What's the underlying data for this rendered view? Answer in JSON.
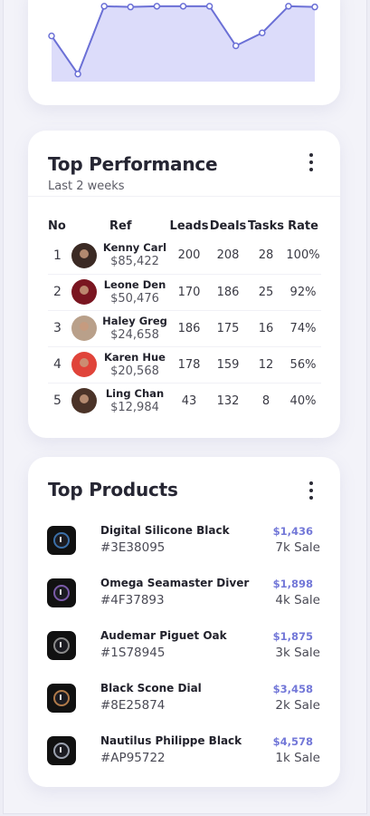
{
  "chart": {
    "fill_color": "#dcdcfa",
    "line_color": "#6b70d6",
    "points": [
      0.6,
      0.1,
      0.99,
      0.98,
      0.99,
      0.99,
      0.99,
      0.47,
      0.64,
      0.99,
      0.98
    ]
  },
  "performance": {
    "title": "Top Performance",
    "subtitle": "Last 2 weeks",
    "columns": [
      "No",
      "Ref",
      "Leads",
      "Deals",
      "Tasks",
      "Rate"
    ],
    "rows": [
      {
        "no": "1",
        "name": "Kenny Carl",
        "amount": "$85,422",
        "leads": "200",
        "deals": "208",
        "tasks": "28",
        "rate": "100%",
        "avatar_color": "#3b2a24"
      },
      {
        "no": "2",
        "name": "Leone Den",
        "amount": "$50,476",
        "leads": "170",
        "deals": "186",
        "tasks": "25",
        "rate": "92%",
        "avatar_color": "#7a1520"
      },
      {
        "no": "3",
        "name": "Haley Greg",
        "amount": "$24,658",
        "leads": "186",
        "deals": "175",
        "tasks": "16",
        "rate": "74%",
        "avatar_color": "#b9a08a"
      },
      {
        "no": "4",
        "name": "Karen Hue",
        "amount": "$20,568",
        "leads": "178",
        "deals": "159",
        "tasks": "12",
        "rate": "56%",
        "avatar_color": "#e0443a"
      },
      {
        "no": "5",
        "name": "Ling Chan",
        "amount": "$12,984",
        "leads": "43",
        "deals": "132",
        "tasks": "8",
        "rate": "40%",
        "avatar_color": "#4b3328"
      }
    ]
  },
  "products": {
    "title": "Top Products",
    "items": [
      {
        "name": "Digital Silicone Black",
        "code": "#3E38095",
        "price": "$1,436",
        "sale": "7k Sale",
        "accent": "#3b6fa8"
      },
      {
        "name": "Omega Seamaster Diver",
        "code": "#4F37893",
        "price": "$1,898",
        "sale": "4k Sale",
        "accent": "#7a5aa8"
      },
      {
        "name": "Audemar Piguet Oak",
        "code": "#1S78945",
        "price": "$1,875",
        "sale": "3k Sale",
        "accent": "#8a8a8a"
      },
      {
        "name": "Black Scone Dial",
        "code": "#8E25874",
        "price": "$3,458",
        "sale": "2k Sale",
        "accent": "#b07a4a"
      },
      {
        "name": "Nautilus Philippe Black",
        "code": "#AP95722",
        "price": "$4,578",
        "sale": "1k Sale",
        "accent": "#9aa0ad"
      }
    ]
  }
}
